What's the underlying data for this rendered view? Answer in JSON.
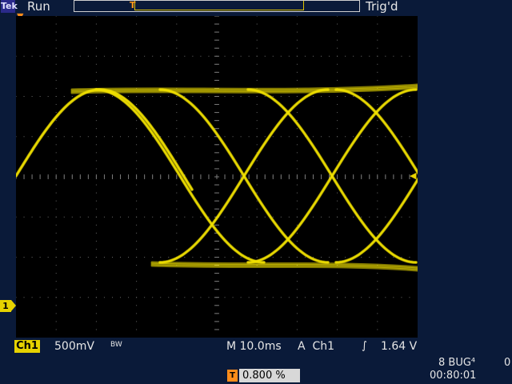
{
  "header": {
    "logo": "Tek",
    "run_state": "Run",
    "trigger_state": "Trig'd",
    "trigger_marker": "T"
  },
  "channel": {
    "marker": "1",
    "label": "Ch1",
    "volts_per_div": "500mV",
    "bandwidth_limit": "BW"
  },
  "timebase": {
    "label": "M 10.0ms"
  },
  "trigger": {
    "mode": "A",
    "source": "Ch1",
    "edge": "∫",
    "level": "1.64 V",
    "position_marker": "T",
    "position": "0.800 %"
  },
  "status": {
    "line1": "8 BUG⁴",
    "line1_right": "0",
    "clock": "00:80:01"
  },
  "colors": {
    "trace": "#f0e000",
    "trigger": "#ff8c1a",
    "background": "#0a1a39",
    "screen": "#000000"
  }
}
